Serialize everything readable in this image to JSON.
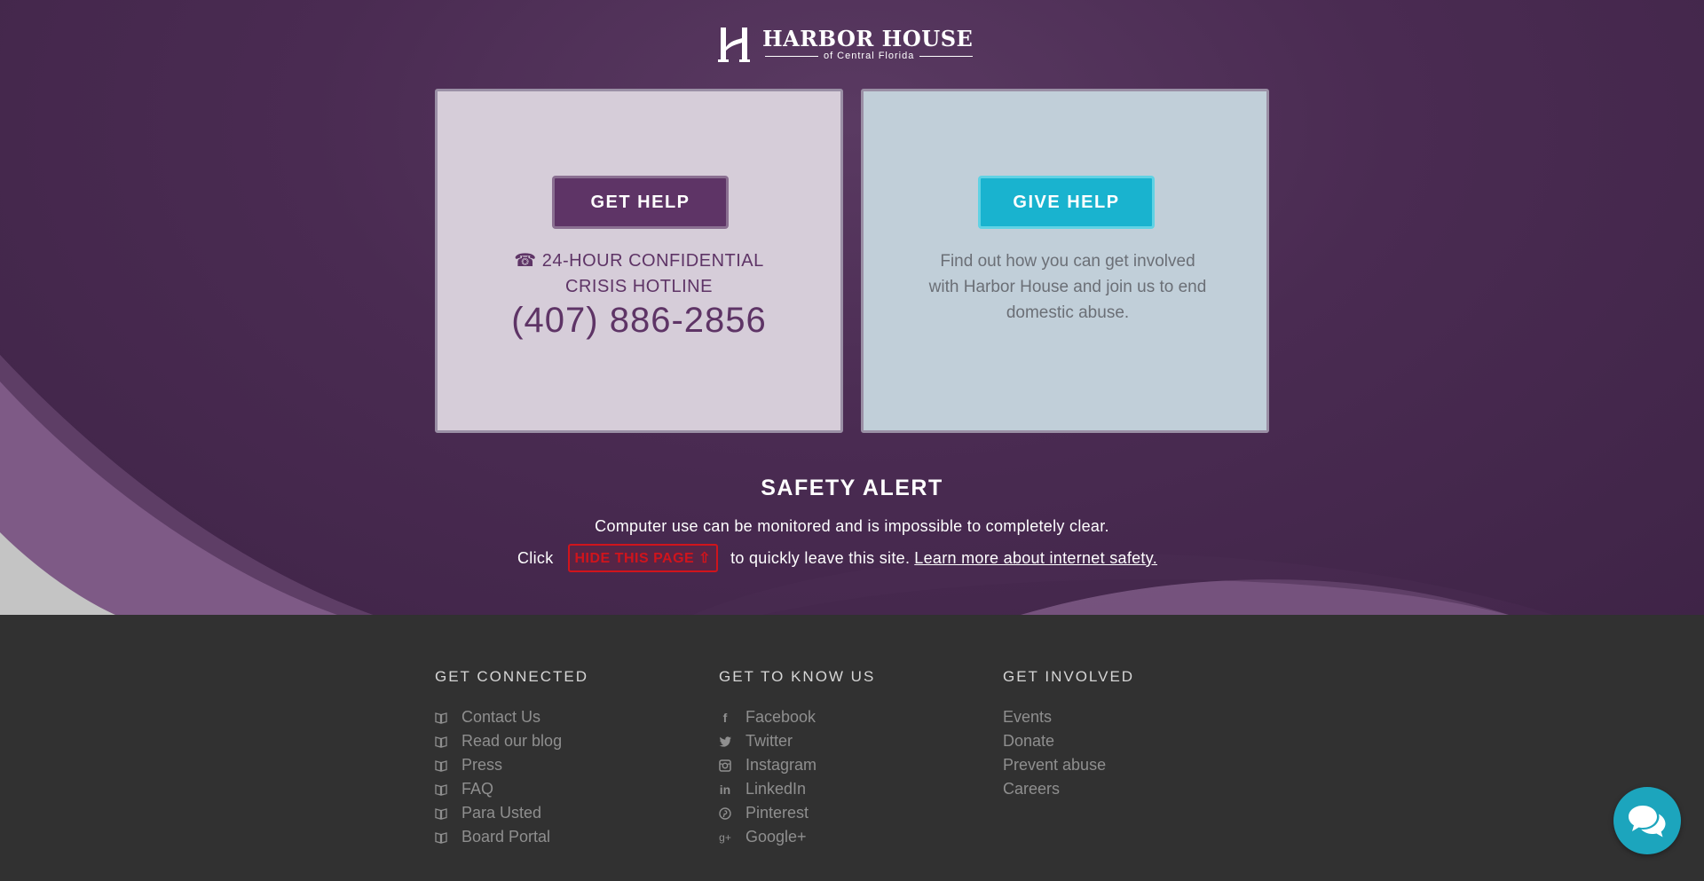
{
  "logo": {
    "title": "HARBOR HOUSE",
    "subtitle": "of Central Florida"
  },
  "cards": {
    "get_help": {
      "button_label": "GET HELP",
      "hotline_icon": "phone-icon",
      "hotline_line1": "☎ 24-HOUR CONFIDENTIAL",
      "hotline_line2": "CRISIS HOTLINE",
      "phone_number": "(407) 886-2856"
    },
    "give_help": {
      "button_label": "GIVE HELP",
      "description": "Find out how you can get involved with Harbor House and join us to end domestic abuse."
    }
  },
  "safety": {
    "title": "SAFETY ALERT",
    "line1": "Computer use can be monitored and is impossible to completely clear.",
    "click_text": "Click",
    "hide_button": "HIDE THIS PAGE ⇧",
    "after_text": "to quickly leave this site.",
    "link_text": "Learn more about internet safety."
  },
  "footer": {
    "columns": [
      {
        "title": "GET CONNECTED",
        "items": [
          {
            "label": "Contact Us",
            "icon": "book-icon"
          },
          {
            "label": "Read our blog",
            "icon": "book-icon"
          },
          {
            "label": "Press",
            "icon": "book-icon"
          },
          {
            "label": "FAQ",
            "icon": "book-icon"
          },
          {
            "label": "Para Usted",
            "icon": "book-icon"
          },
          {
            "label": "Board Portal",
            "icon": "book-icon"
          }
        ]
      },
      {
        "title": "GET TO KNOW US",
        "items": [
          {
            "label": "Facebook",
            "icon": "facebook-icon"
          },
          {
            "label": "Twitter",
            "icon": "twitter-icon"
          },
          {
            "label": "Instagram",
            "icon": "instagram-icon"
          },
          {
            "label": "LinkedIn",
            "icon": "linkedin-icon"
          },
          {
            "label": "Pinterest",
            "icon": "pinterest-icon"
          },
          {
            "label": "Google+",
            "icon": "google-plus-icon"
          }
        ]
      },
      {
        "title": "GET INVOLVED",
        "items": [
          {
            "label": "Events"
          },
          {
            "label": "Donate"
          },
          {
            "label": "Prevent abuse"
          },
          {
            "label": "Careers"
          }
        ]
      }
    ]
  },
  "chat": {
    "icon": "chat-icon"
  },
  "colors": {
    "brand_purple": "#5e3466",
    "brand_teal": "#19b3cf",
    "alert_red": "#d0141c",
    "footer_bg": "#313131"
  }
}
